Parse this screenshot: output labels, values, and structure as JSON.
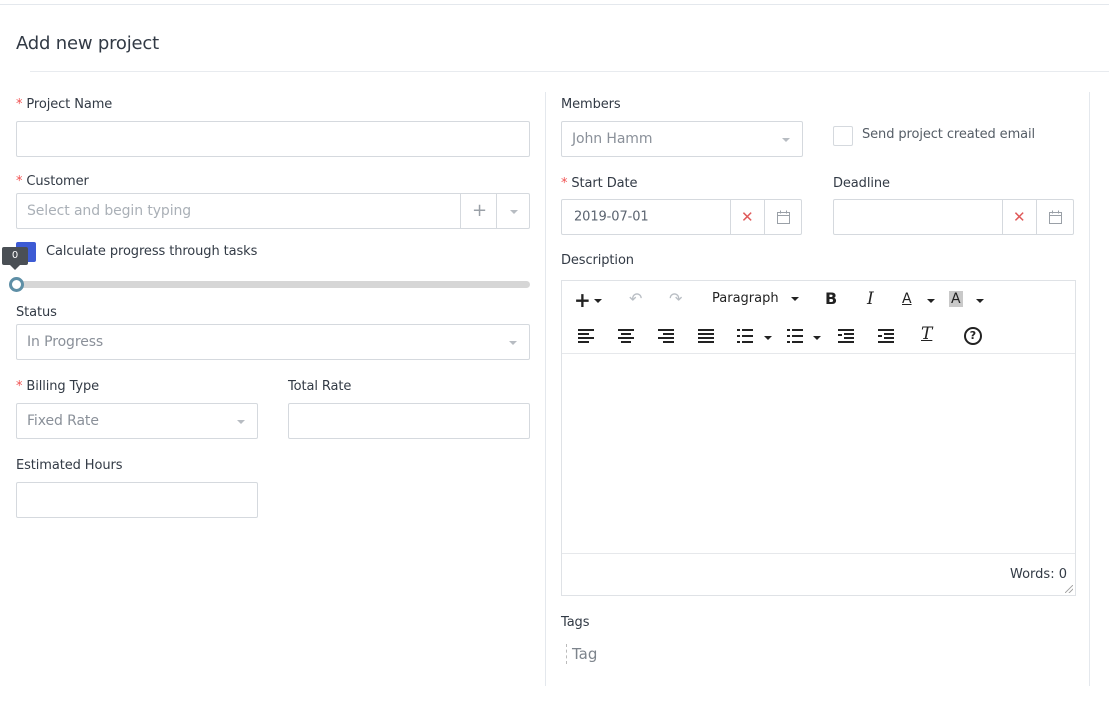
{
  "page": {
    "title": "Add new project"
  },
  "left": {
    "project_name": {
      "label": "Project Name",
      "required": "*",
      "value": ""
    },
    "customer": {
      "label": "Customer",
      "required": "*",
      "placeholder": "Select and begin typing"
    },
    "calc_progress": {
      "label": "Calculate progress through tasks",
      "checked": true
    },
    "progress": {
      "value_label": "0",
      "value": 0
    },
    "status": {
      "label": "Status",
      "value": "In Progress"
    },
    "billing_type": {
      "label": "Billing Type",
      "required": "*",
      "value": "Fixed Rate"
    },
    "total_rate": {
      "label": "Total Rate",
      "value": ""
    },
    "estimated_hours": {
      "label": "Estimated Hours",
      "value": ""
    }
  },
  "right": {
    "members": {
      "label": "Members",
      "value": "John Hamm"
    },
    "send_email": {
      "label": "Send project created email",
      "checked": false
    },
    "start_date": {
      "label": "Start Date",
      "required": "*",
      "value": "2019-07-01"
    },
    "deadline": {
      "label": "Deadline",
      "value": ""
    },
    "description": {
      "label": "Description",
      "format_select": "Paragraph",
      "bold": "B",
      "italic": "I",
      "font_color": "A",
      "bg_color": "A",
      "clear_format": "T",
      "help": "?",
      "words_label": "Words: 0"
    },
    "tags": {
      "label": "Tags",
      "placeholder": "Tag"
    }
  },
  "colors": {
    "accent": "#3d5bd4",
    "required": "#f05050",
    "clear_icon": "#e05a5a"
  },
  "icons": [
    "plus-icon",
    "chevron-down-icon",
    "calendar-icon",
    "close-icon",
    "undo-icon",
    "redo-icon",
    "align-left-icon",
    "align-center-icon",
    "align-right-icon",
    "align-justify-icon",
    "bullet-list-icon",
    "numbered-list-icon",
    "outdent-icon",
    "indent-icon",
    "clear-format-icon",
    "help-icon"
  ]
}
